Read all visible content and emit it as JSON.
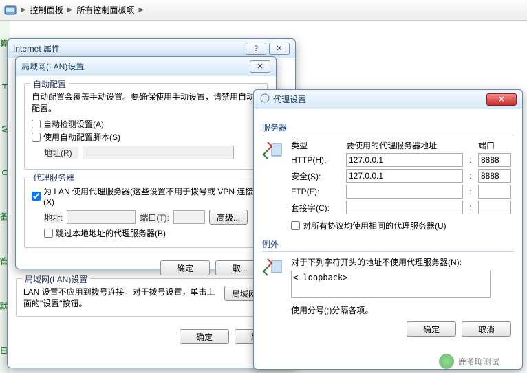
{
  "breadcrumb": {
    "a": "控制面板",
    "b": "所有控制面板项"
  },
  "win1": {
    "title": "Internet 属性",
    "lan_section_title": "局域网(LAN)设置",
    "lan_help": "LAN 设置不应用到拨号连接。对于拨号设置，单击上面的\"设置\"按钮。",
    "lan_btn": "局域网设...",
    "ok": "确定",
    "cancel": "取消"
  },
  "win2": {
    "title": "局域网(LAN)设置",
    "grp_auto": "自动配置",
    "auto_note": "自动配置会覆盖手动设置。要确保使用手动设置，请禁用自动配置。",
    "auto_detect": "自动检测设置(A)",
    "auto_script": "使用自动配置脚本(S)",
    "addr_label": "地址(R)",
    "grp_proxy": "代理服务器",
    "use_proxy": "为 LAN 使用代理服务器(这些设置不用于拨号或 VPN 连接)(X)",
    "addr2_label": "地址:",
    "port_label": "端口(T):",
    "adv_btn": "高级...",
    "bypass_local": "跳过本地地址的代理服务器(B)",
    "ok": "确定",
    "cancel": "取..."
  },
  "win3": {
    "title": "代理设置",
    "servers": "服务器",
    "h_type": "类型",
    "h_addr": "要使用的代理服务器地址",
    "h_port": "端口",
    "rows": {
      "http": {
        "label": "HTTP(H):",
        "addr": "127.0.0.1",
        "port": "8888"
      },
      "secure": {
        "label": "安全(S):",
        "addr": "127.0.0.1",
        "port": "8888"
      },
      "ftp": {
        "label": "FTP(F):",
        "addr": "",
        "port": ""
      },
      "socks": {
        "label": "套接字(C):",
        "addr": "",
        "port": ""
      }
    },
    "same_all": "对所有协议均使用相同的代理服务器(U)",
    "exceptions": "例外",
    "except_note": "对于下列字符开头的地址不使用代理服务器(N):",
    "except_val": "<-loopback>",
    "except_hint": "使用分号(;)分隔各项。",
    "ok": "确定",
    "cancel": "取消"
  },
  "watermark": "鹿爷聊测试"
}
